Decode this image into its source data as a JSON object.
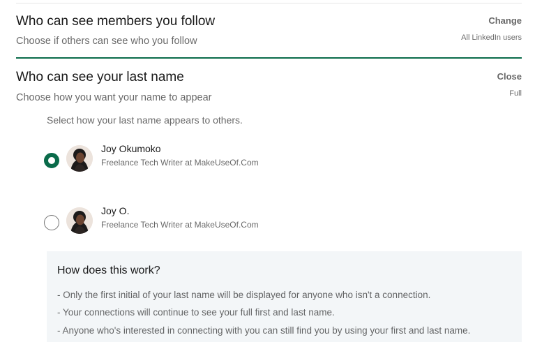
{
  "sections": [
    {
      "title": "Who can see members you follow",
      "subtitle": "Choose if others can see who you follow",
      "action": "Change",
      "value": "All LinkedIn users"
    },
    {
      "title": "Who can see your last name",
      "subtitle": "Choose how you want your name to appear",
      "action": "Close",
      "value": "Full",
      "prompt": "Select how your last name appears to others.",
      "options": [
        {
          "name": "Joy Okumoko",
          "headline": "Freelance Tech Writer at MakeUseOf.Com",
          "selected": true
        },
        {
          "name": "Joy O.",
          "headline": "Freelance Tech Writer at MakeUseOf.Com",
          "selected": false
        }
      ]
    }
  ],
  "info": {
    "title": "How does this work?",
    "items": [
      "- Only the first initial of your last name will be displayed for anyone who isn't a connection.",
      "- Your connections will continue to see your full first and last name.",
      "- Anyone who's interested in connecting with you can still find you by using your first and last name."
    ]
  },
  "colors": {
    "accent": "#0a6b4a",
    "info_bg": "#f3f6f8"
  }
}
